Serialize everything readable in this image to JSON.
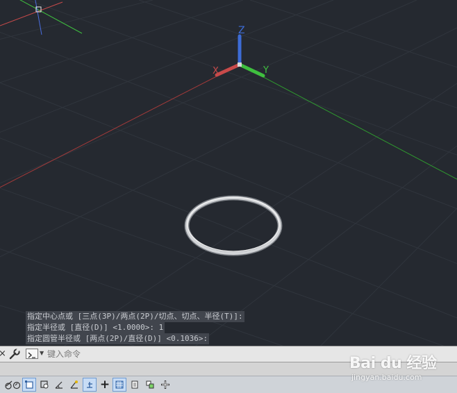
{
  "viewport": {
    "background": "#252930",
    "axis_labels": {
      "x": "X",
      "y": "Y",
      "z": "Z"
    },
    "axis_colors": {
      "x": "#c84a4a",
      "y": "#3fbf3f",
      "z": "#3d6cd6"
    },
    "object": "torus"
  },
  "command_history": [
    "指定中心点或 [三点(3P)/两点(2P)/切点、切点、半径(T)]:",
    "指定半径或 [直径(D)] <1.0000>: 1",
    "指定圆管半径或 [两点(2P)/直径(D)] <0.1036>:"
  ],
  "command_bar": {
    "close_glyph": "×",
    "placeholder": "键入命令"
  },
  "statusbar": {
    "buttons": [
      {
        "icon": "object-snap-tracking-icon",
        "active": false
      },
      {
        "icon": "grid-display-icon",
        "active": true
      },
      {
        "icon": "snap-mode-icon",
        "active": false
      },
      {
        "icon": "dynamic-ucs-icon",
        "active": false
      },
      {
        "icon": "object-snap-icon",
        "active": false
      },
      {
        "icon": "dynamic-input-icon",
        "active": true
      },
      {
        "icon": "ortho-mode-icon",
        "active": false
      },
      {
        "icon": "transparency-icon",
        "active": true
      },
      {
        "icon": "quick-properties-icon",
        "active": false
      },
      {
        "icon": "selection-cycling-icon",
        "active": false
      },
      {
        "icon": "annotation-monitor-icon",
        "active": false
      }
    ]
  },
  "watermark": {
    "brand": "Bai du 经验",
    "url": "jingyan.baidu.com"
  }
}
